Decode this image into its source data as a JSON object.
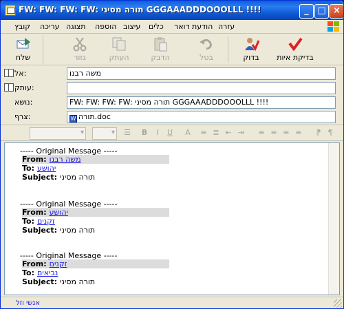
{
  "window": {
    "title": "FW: FW: FW: FW: תורה מסיני  GGGAAADDDOOOLLL !!!!",
    "min_glyph": "_",
    "max_glyph": "□",
    "close_glyph": "×"
  },
  "menu": {
    "items": [
      "קובץ",
      "עריכה",
      "תצוגה",
      "הוספה",
      "עיצוב",
      "כלים",
      "הודעת דואר",
      "עזרה"
    ]
  },
  "toolbar": {
    "send_label": "שלח",
    "cut_label": "גזור",
    "copy_label": "העתק",
    "paste_label": "הדבק",
    "undo_label": "בטל",
    "check_label": "בדוק",
    "spelling_label": "בדיקת איות"
  },
  "fields": {
    "to_label": "אל:",
    "to_value": "משה רבנו",
    "cc_label": "עותק:",
    "cc_value": "",
    "subject_label": "נושא:",
    "subject_value": "FW: FW: FW: FW: תורה מסיני  GGGAAADDDOOOLLL !!!!",
    "attach_label": "צרף:",
    "attach_value": "תורה.doc"
  },
  "format": {
    "font_size_placeholder": "",
    "font_placeholder": "",
    "bold": "B",
    "italic": "I",
    "underline": "U",
    "font_sample": "A",
    "color_sample": "A"
  },
  "body": {
    "messages": [
      {
        "divider": "----- Original Message -----",
        "from_label": "From:",
        "from_value": "משה רבנו",
        "to_label": "To:",
        "to_value": "יהושע",
        "subject_label": "Subject:",
        "subject_value": "תורה מסיני"
      },
      {
        "divider": "----- Original Message -----",
        "from_label": "From:",
        "from_value": "יהושע",
        "to_label": "To:",
        "to_value": "זקנים",
        "subject_label": "Subject:",
        "subject_value": "תורה מסיני"
      },
      {
        "divider": "----- Original Message -----",
        "from_label": "From:",
        "from_value": "זקנים",
        "to_label": "To:",
        "to_value": "נביאים",
        "subject_label": "Subject:",
        "subject_value": "תורה מסיני"
      }
    ]
  },
  "status": {
    "text": "אנשי וזל"
  },
  "colors": {
    "titlebar": "#0a5fd8",
    "link": "#1a1ae6",
    "chrome": "#ece9d8"
  }
}
